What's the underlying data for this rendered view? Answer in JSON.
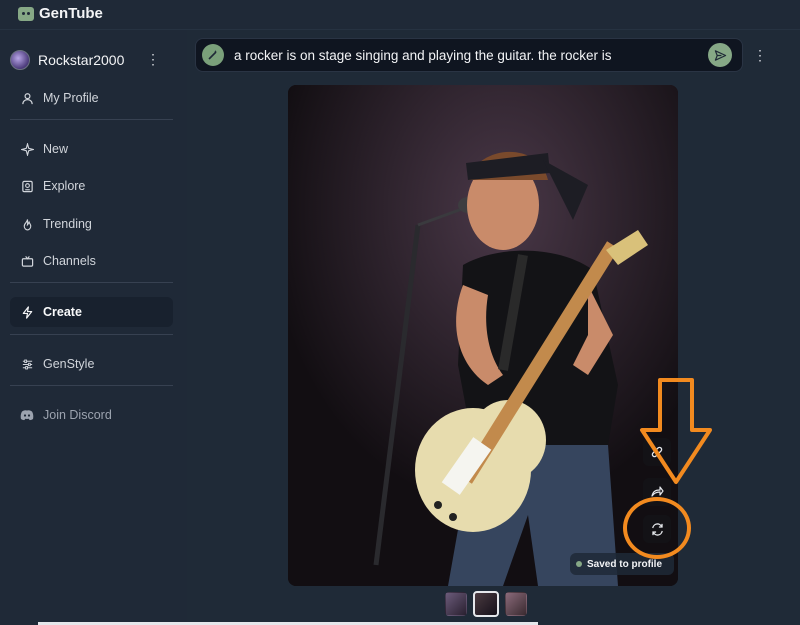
{
  "app": {
    "name": "GenTube"
  },
  "user": {
    "name": "Rockstar2000"
  },
  "sidebar": {
    "items": [
      {
        "label": "My Profile",
        "icon": "person-icon"
      },
      {
        "label": "New",
        "icon": "sparkle-icon"
      },
      {
        "label": "Explore",
        "icon": "explore-icon"
      },
      {
        "label": "Trending",
        "icon": "flame-icon"
      },
      {
        "label": "Channels",
        "icon": "tv-icon"
      },
      {
        "label": "Create",
        "icon": "bolt-icon",
        "active": true
      },
      {
        "label": "GenStyle",
        "icon": "sliders-icon"
      },
      {
        "label": "Join Discord",
        "icon": "discord-icon"
      }
    ]
  },
  "prompt": {
    "text": "a rocker is on stage singing and playing the guitar. the rocker is",
    "wand_icon": "magic-wand-icon",
    "send_icon": "send-icon"
  },
  "image": {
    "description_alt": "rocker singing and playing guitar on stage",
    "side_buttons": [
      "link-icon",
      "share-icon",
      "regenerate-icon"
    ],
    "saved_label": "Saved to profile"
  },
  "thumbnails": {
    "count": 3,
    "selected_index": 1
  },
  "colors": {
    "accent": "#86a886",
    "annotation": "#f28a1f",
    "background": "#1f2937"
  }
}
